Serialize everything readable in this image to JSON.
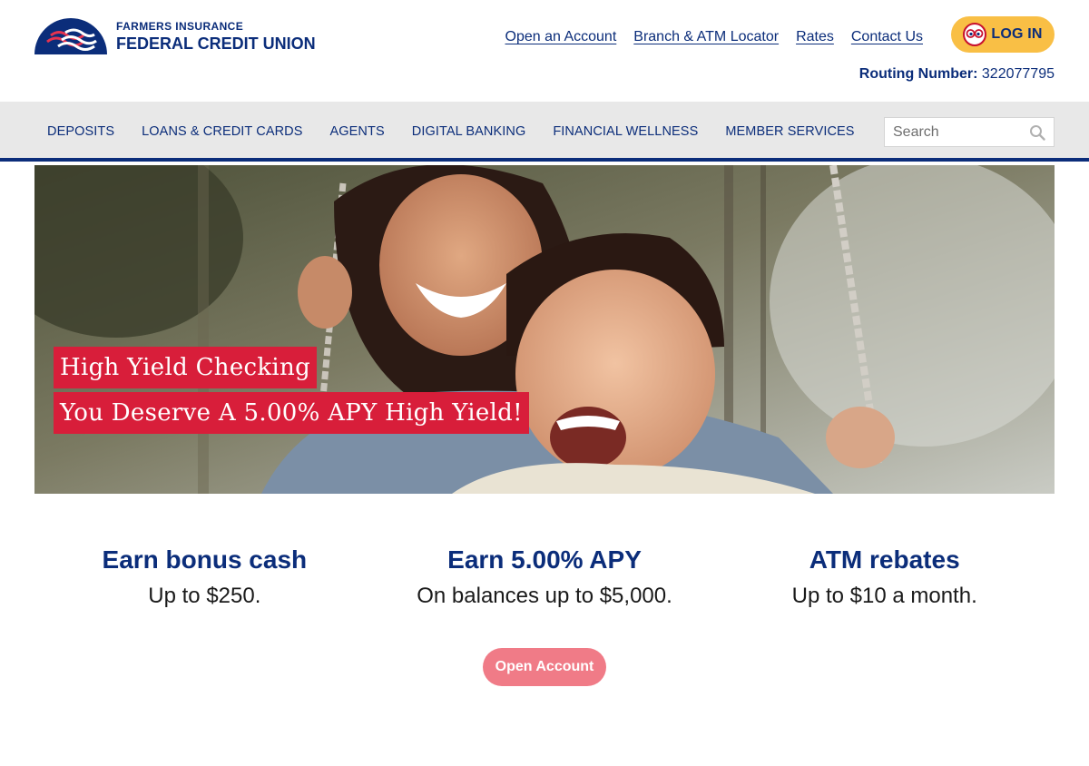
{
  "brand": {
    "name_top": "FARMERS INSURANCE",
    "name_bottom": "FEDERAL CREDIT UNION",
    "logo_icon": "rainbow-arches-logo",
    "primary_color": "#0b2d7a",
    "accent_color": "#d81e3a"
  },
  "header": {
    "links": [
      {
        "label": "Open an Account"
      },
      {
        "label": "Branch & ATM Locator"
      },
      {
        "label": "Rates"
      },
      {
        "label": "Contact Us"
      }
    ],
    "login": {
      "label": "LOG IN",
      "icon": "eyes-avatar-icon",
      "color": "#f9bf45"
    },
    "routing": {
      "label": "Routing Number:",
      "value": "322077795"
    }
  },
  "nav": {
    "items": [
      {
        "label": "DEPOSITS"
      },
      {
        "label": "LOANS & CREDIT CARDS"
      },
      {
        "label": "AGENTS"
      },
      {
        "label": "DIGITAL BANKING"
      },
      {
        "label": "FINANCIAL WELLNESS"
      },
      {
        "label": "MEMBER SERVICES"
      }
    ],
    "search": {
      "placeholder": "Search",
      "icon": "search-icon"
    }
  },
  "hero": {
    "headline": "High Yield Checking",
    "subheadline": "You Deserve A 5.00% APY High Yield!",
    "image": "mother-and-daughter-on-swing-photo"
  },
  "features": [
    {
      "title": "Earn bonus cash",
      "text": "Up to $250."
    },
    {
      "title": "Earn 5.00% APY",
      "text": "On balances up to $5,000."
    },
    {
      "title": "ATM rebates",
      "text": "Up to $10 a month."
    }
  ],
  "cta": {
    "label": "Open Account",
    "color": "#f07b87"
  }
}
